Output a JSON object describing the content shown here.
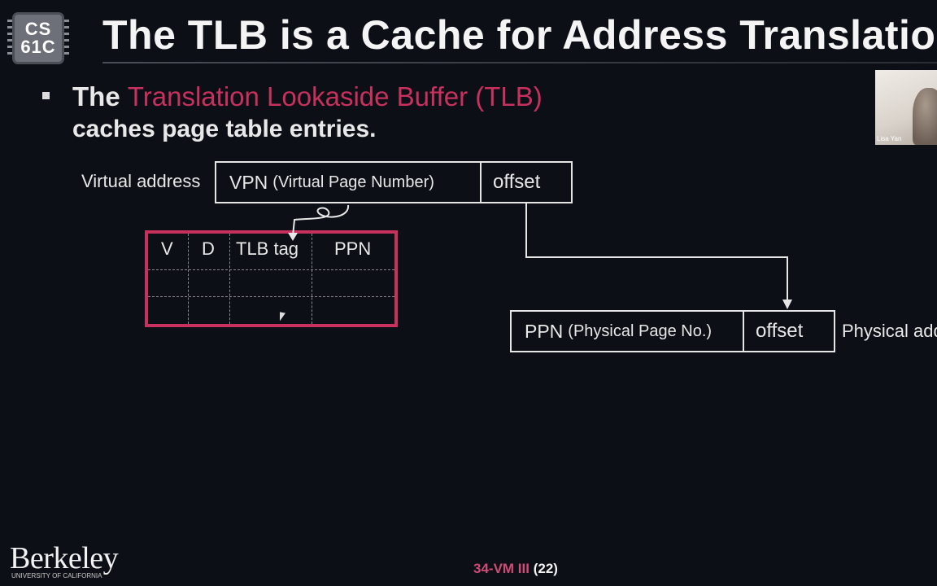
{
  "header": {
    "logo_line1": "CS",
    "logo_line2": "61C",
    "title": "The TLB is a Cache for Address Translation"
  },
  "bullet": {
    "lead": "The ",
    "highlight": "Translation Lookaside Buffer (TLB)",
    "line2": "caches page table entries."
  },
  "webcam": {
    "name": "Lisa Yan"
  },
  "virtual_address": {
    "label": "Virtual address",
    "vpn": "VPN",
    "vpn_sub": "(Virtual Page Number)",
    "offset": "offset"
  },
  "tlb": {
    "columns": [
      "V",
      "D",
      "TLB tag",
      "PPN"
    ]
  },
  "physical_address": {
    "label": "Physical address",
    "ppn": "PPN",
    "ppn_sub": "(Physical Page No.)",
    "offset": "offset"
  },
  "footer": {
    "university": "Berkeley",
    "university_sub": "UNIVERSITY OF CALIFORNIA",
    "slide_prefix": "34-VM III",
    "slide_number": "(22)"
  },
  "colors": {
    "accent": "#c8315d",
    "background": "#0c0f15",
    "text": "#e8e8e8"
  }
}
